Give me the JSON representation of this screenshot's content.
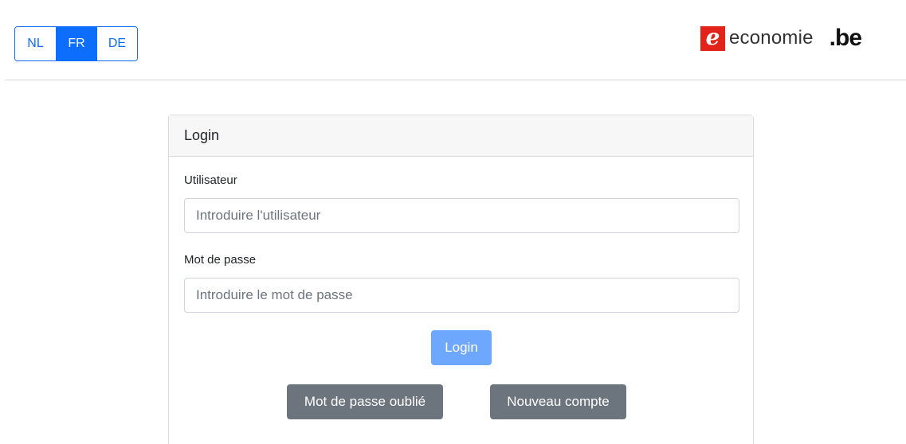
{
  "header": {
    "languages": [
      {
        "code": "NL",
        "active": false
      },
      {
        "code": "FR",
        "active": true
      },
      {
        "code": "DE",
        "active": false
      }
    ],
    "brand": {
      "mark_letter": "e",
      "name": "economie",
      "domain": ".be",
      "mark_color": "#e2231a"
    }
  },
  "login_card": {
    "title": "Login",
    "username": {
      "label": "Utilisateur",
      "value": "",
      "placeholder": "Introduire l'utilisateur"
    },
    "password": {
      "label": "Mot de passe",
      "value": "",
      "placeholder": "Introduire le mot de passe"
    },
    "login_button": "Login",
    "forgot_password_button": "Mot de passe oublié",
    "new_account_button": "Nouveau compte"
  },
  "colors": {
    "accent": "#0d6efd",
    "login_button": "#6ea8fe",
    "secondary_button": "#6c757d"
  }
}
